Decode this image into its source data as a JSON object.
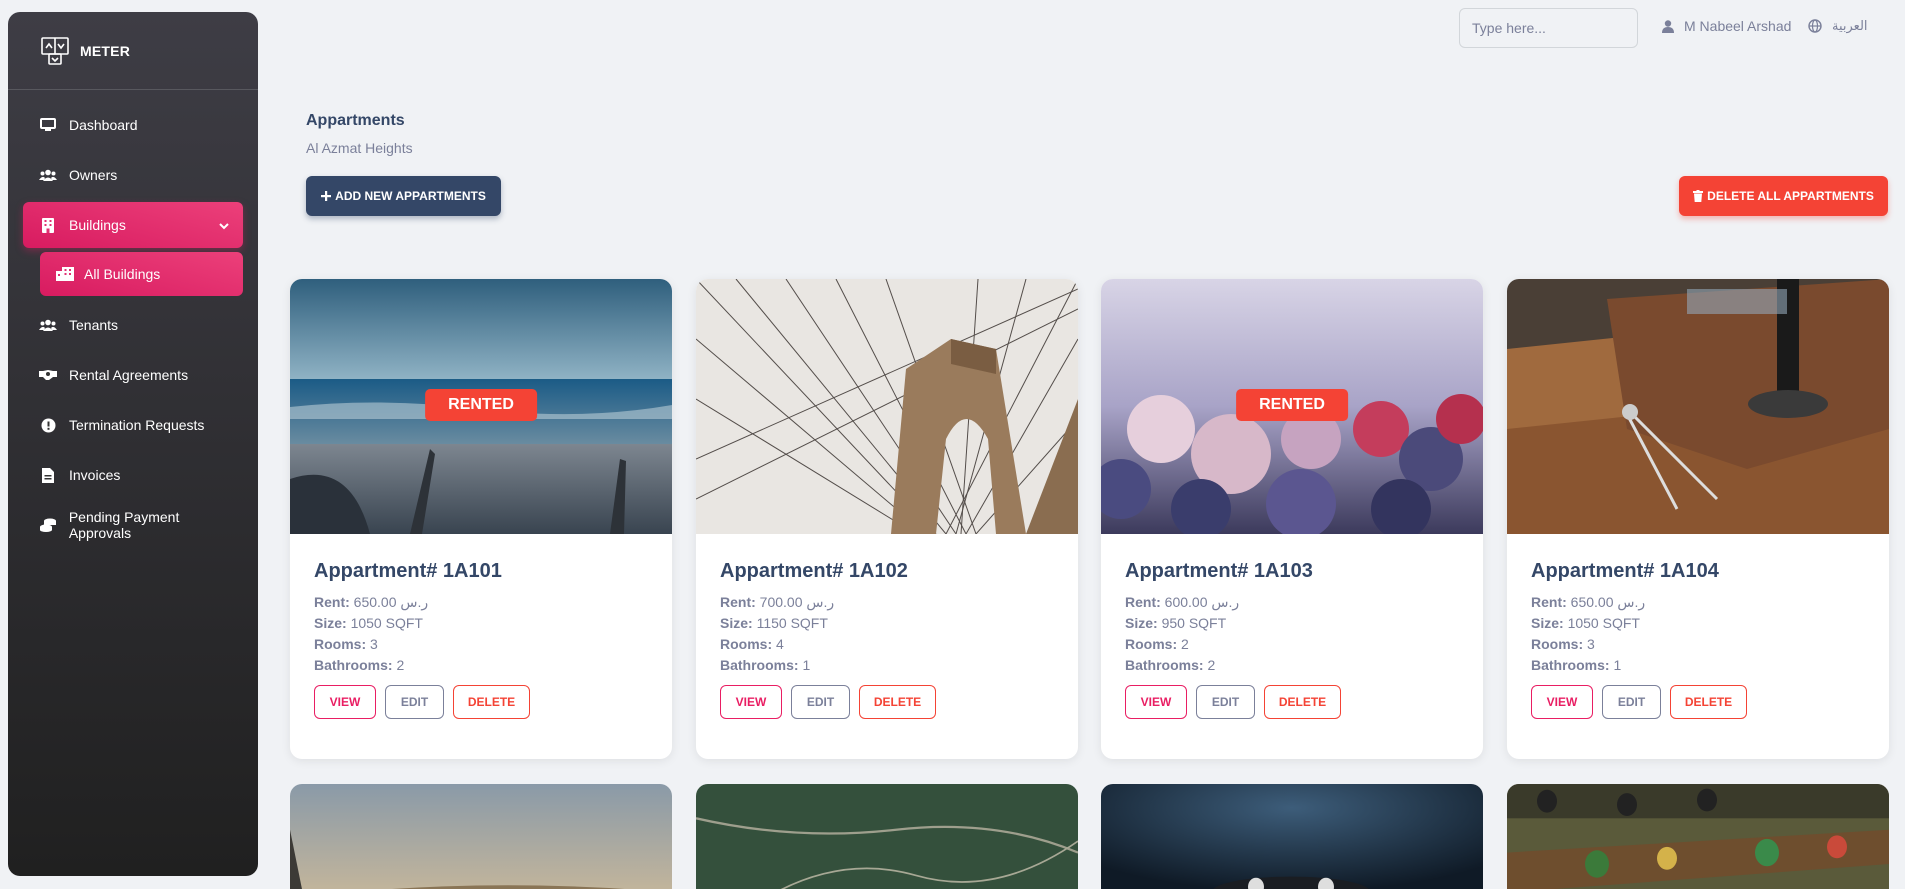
{
  "brand": {
    "name": "METER",
    "logo_icon": "meter-logo-icon"
  },
  "sidebar": {
    "items": [
      {
        "label": "Dashboard",
        "icon": "monitor-icon"
      },
      {
        "label": "Owners",
        "icon": "users-icon"
      },
      {
        "label": "Buildings",
        "icon": "building-icon",
        "active": true
      },
      {
        "label": "All Buildings",
        "icon": "city-icon",
        "sub": true
      },
      {
        "label": "Tenants",
        "icon": "users-icon"
      },
      {
        "label": "Rental Agreements",
        "icon": "handshake-icon"
      },
      {
        "label": "Termination Requests",
        "icon": "alert-circle-icon"
      },
      {
        "label": "Invoices",
        "icon": "file-icon"
      },
      {
        "label": "Pending Payment Approvals",
        "icon": "coins-icon"
      }
    ]
  },
  "topbar": {
    "search_placeholder": "Type here...",
    "user_name": "M Nabeel Arshad",
    "language": "العربية"
  },
  "header": {
    "title": "Appartments",
    "subtitle": "Al Azmat Heights",
    "add_button": "ADD NEW APPARTMENTS",
    "delete_all_button": "DELETE ALL APPARTMENTS"
  },
  "labels": {
    "rent": "Rent:",
    "size": "Size:",
    "rooms": "Rooms:",
    "bathrooms": "Bathrooms:",
    "view": "VIEW",
    "edit": "EDIT",
    "delete": "DELETE",
    "rented": "RENTED"
  },
  "apartments": [
    {
      "title": "Appartment# 1A101",
      "rent": "650.00 ر.س",
      "size": "1050 SQFT",
      "rooms": "3",
      "bathrooms": "2",
      "rented": true
    },
    {
      "title": "Appartment# 1A102",
      "rent": "700.00 ر.س",
      "size": "1150 SQFT",
      "rooms": "4",
      "bathrooms": "1",
      "rented": false
    },
    {
      "title": "Appartment# 1A103",
      "rent": "600.00 ر.س",
      "size": "950 SQFT",
      "rooms": "2",
      "bathrooms": "2",
      "rented": true
    },
    {
      "title": "Appartment# 1A104",
      "rent": "650.00 ر.س",
      "size": "1050 SQFT",
      "rooms": "3",
      "bathrooms": "1",
      "rented": false
    }
  ],
  "colors": {
    "primary": "#e91e63",
    "danger": "#f44335",
    "dark": "#344767",
    "muted": "#7b809a"
  }
}
